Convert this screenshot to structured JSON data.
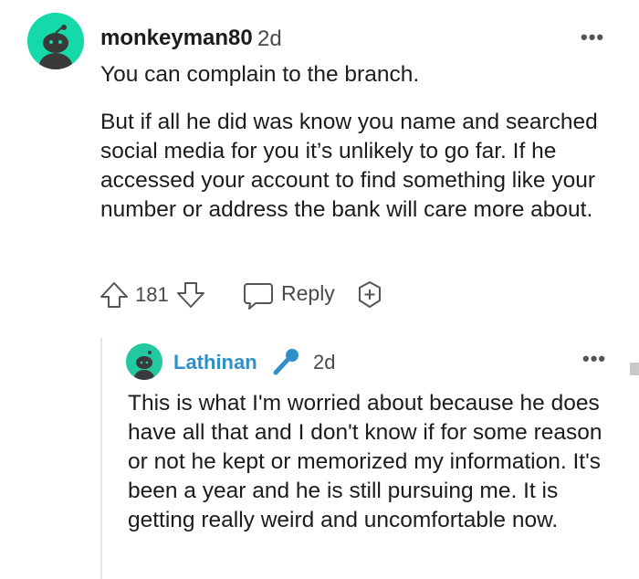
{
  "top_comment": {
    "username": "monkeyman80",
    "time": "2d",
    "more": "•••",
    "paragraphs": [
      "You can complain to the branch.",
      "But if all he did was know you name and searched social media for you it’s unlikely to go far. If he accessed your account to find something like your number or address the bank will care more about."
    ],
    "votes": "181",
    "reply_label": "Reply",
    "avatar_color": "#14d9a8"
  },
  "reply_comment": {
    "username": "Lathinan",
    "time": "2d",
    "more": "•••",
    "text": "This is what I'm worried about because he does have all that and I don't know if for some reason or not he kept or memorized my information. It's been a year and he is still pursuing me. It is getting really weird and uncomfortable now.",
    "username_color": "#2f90c8",
    "avatar_color": "#22c8a0"
  },
  "icons": [
    "snoo-avatar-icon",
    "upvote-icon",
    "downvote-icon",
    "reply-bubble-icon",
    "award-icon",
    "microphone-icon",
    "more-options-icon"
  ]
}
